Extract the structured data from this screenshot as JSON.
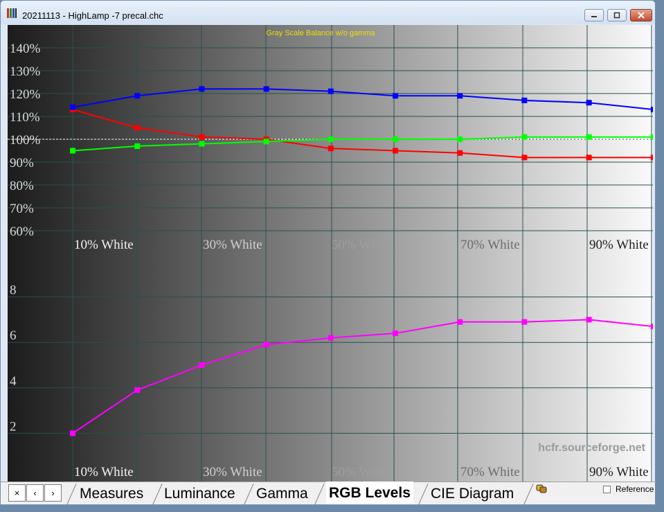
{
  "window": {
    "title": "20211113 - HighLamp -7 precal.chc",
    "minimize_icon": "minimize-icon",
    "maximize_icon": "maximize-icon",
    "close_icon": "close-icon"
  },
  "tabs": {
    "nav": [
      "×",
      "‹",
      "›"
    ],
    "items": [
      "Measures",
      "Luminance",
      "Gamma",
      "RGB Levels",
      "CIE Diagram"
    ],
    "active": "RGB Levels",
    "reference_label": "Reference",
    "reference_checked": false
  },
  "colors": {
    "red": "#ff0000",
    "green": "#00ff00",
    "blue": "#0000ff",
    "delta_e": "#ff00ff",
    "title": "#e8e000",
    "grid": "#2a4f4f",
    "watermark": "#9a9a9a"
  },
  "chart_data": [
    {
      "type": "line",
      "title": "Gray Scale Balance w/o gamma",
      "x": [
        10,
        20,
        30,
        40,
        50,
        60,
        70,
        80,
        90,
        100
      ],
      "x_tick_labels": [
        "10% White",
        "30% White",
        "50% White",
        "70% White",
        "90% White"
      ],
      "y_tick_labels": [
        "140%",
        "130%",
        "120%",
        "110%",
        "100%",
        "90%",
        "80%",
        "70%",
        "60%"
      ],
      "ylim": [
        60,
        144
      ],
      "reference_line": 100,
      "grid": true,
      "series": [
        {
          "name": "Red",
          "color": "#ff0000",
          "values": [
            113,
            105,
            101,
            100,
            96,
            95,
            94,
            92,
            92,
            92
          ]
        },
        {
          "name": "Green",
          "color": "#00ff00",
          "values": [
            95,
            97,
            98,
            99,
            100,
            100,
            100,
            101,
            101,
            101
          ]
        },
        {
          "name": "Blue",
          "color": "#0000ff",
          "values": [
            114,
            119,
            122,
            122,
            121,
            119,
            119,
            117,
            116,
            113
          ]
        }
      ]
    },
    {
      "type": "line",
      "x": [
        10,
        20,
        30,
        40,
        50,
        60,
        70,
        80,
        90,
        100
      ],
      "x_tick_labels": [
        "10% White",
        "30% White",
        "50% White",
        "70% White",
        "90% White"
      ],
      "y_tick_labels": [
        "8",
        "6",
        "4",
        "2"
      ],
      "ylim": [
        0,
        9
      ],
      "grid": true,
      "watermark": "hcfr.sourceforge.net",
      "series": [
        {
          "color": "#ff00ff",
          "values": [
            2.0,
            3.9,
            5.0,
            5.9,
            6.2,
            6.4,
            6.9,
            6.9,
            7.0,
            6.7
          ]
        }
      ]
    }
  ]
}
